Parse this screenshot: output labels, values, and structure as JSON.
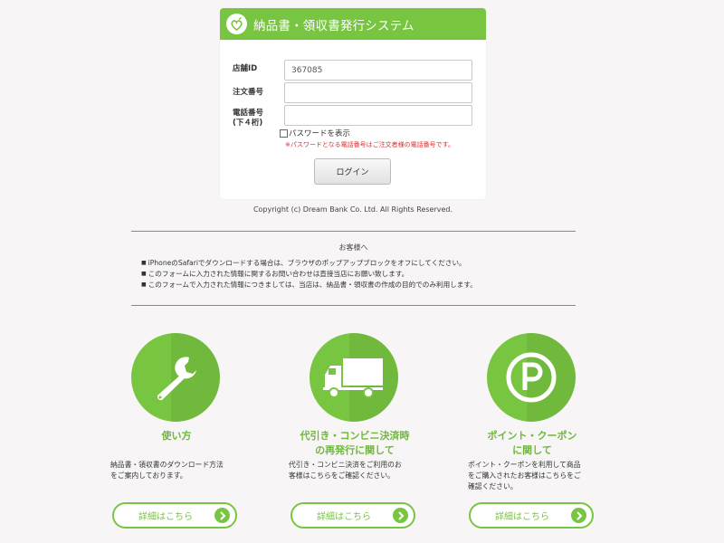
{
  "app": {
    "title": "納品書・領収書発行システム"
  },
  "form": {
    "store_id_label": "店舗ID",
    "store_id_value": "367085",
    "order_no_label": "注文番号",
    "order_no_value": "",
    "phone_label_line1": "電話番号",
    "phone_label_line2": "(下４桁)",
    "phone_value": "",
    "show_password_label": "パスワードを表示",
    "note": "※パスワードとなる電話番号はご注文者様の電話番号です。",
    "login_label": "ログイン"
  },
  "copyright": "Copyright (c)  Dream Bank Co. Ltd. All Rights Reserved.",
  "notice": {
    "title": "お客様へ",
    "items": [
      "iPhoneのSafariでダウンロードする場合は、ブラウザのポップアップブロックをオフにしてください。",
      "このフォームに入力された情報に関するお問い合わせは直接当店にお願い致します。",
      "このフォームで入力された情報につきましては、当店は、納品書・領収書の作成の目的でのみ利用します。"
    ]
  },
  "features": [
    {
      "icon": "wrench-icon",
      "title_lines": [
        "使い方"
      ],
      "desc_lines": [
        "納品書・領収書のダウンロード方法",
        "をご案内しております。"
      ],
      "button": "詳細はこちら"
    },
    {
      "icon": "truck-icon",
      "title_lines": [
        "代引き・コンビニ決済時",
        "の再発行に関して"
      ],
      "desc_lines": [
        "代引き・コンビニ決済をご利用のお",
        "客様はこちらをご確認ください。"
      ],
      "button": "詳細はこちら"
    },
    {
      "icon": "point-icon",
      "title_lines": [
        "ポイント・クーポン",
        "に関して"
      ],
      "desc_lines": [
        "ポイント・クーポンを利用して商品",
        "をご購入されたお客様はこちらをご",
        "確認ください。"
      ],
      "button": "詳細はこちら"
    }
  ],
  "colors": {
    "accent": "#78c541",
    "warning": "#e03030",
    "background": "#f7f5f6"
  }
}
